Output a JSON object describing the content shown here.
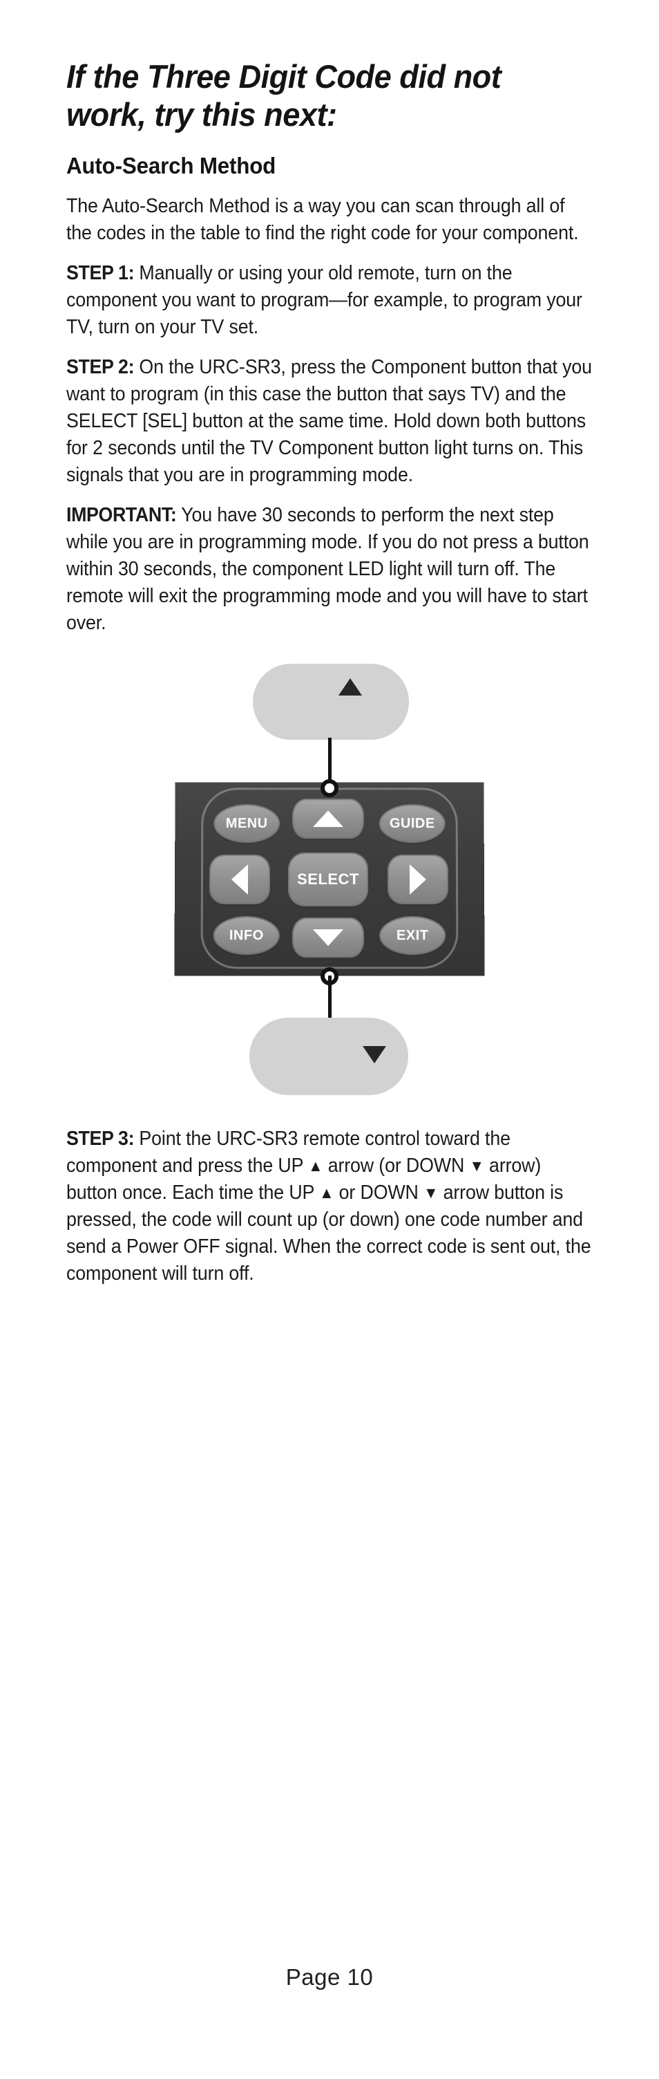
{
  "document": {
    "title": "If the Three Digit Code did not work, try this next:",
    "section_heading": "Auto-Search Method",
    "intro_paragraph": "The Auto-Search Method is a way you can scan through all of the codes in the table to find the right code for your component.",
    "steps": [
      {
        "label": "STEP 1:",
        "text": " Manually or using your old remote, turn on the component you want to program—for example, to program your TV, turn on your TV set."
      },
      {
        "label": "STEP 2:",
        "text": " On the URC-SR3, press the Component button that you want to program (in this case the button that says TV) and the SELECT [SEL] button at the same time. Hold down both buttons for 2 seconds until the TV Component button light turns on. This signals that you are in programming mode."
      }
    ],
    "important": {
      "label": "IMPORTANT:",
      "text": " You have 30 seconds to perform the next step while you are in programming mode. If you do not press a button within 30 seconds, the component LED light will turn off. The remote will exit the programming mode and you will have to start over."
    },
    "step3": {
      "label": "STEP 3:",
      "part1": " Point the URC-SR3 remote control toward the component and press the UP ",
      "up_arrow": "▲",
      "part2": " arrow (or DOWN ",
      "down_arrow": "▼",
      "part3": " arrow) button once. Each time the UP ",
      "up_arrow2": "▲",
      "part4": " or DOWN ",
      "down_arrow2": "▼",
      "part5": " arrow button is pressed, the code will count up (or down) one code number and send a Power OFF signal. When the correct code is sent out, the component will turn off."
    },
    "footer": "Page 10"
  },
  "diagram": {
    "name": "urc-sr3-navigation-pad",
    "callout_top": {
      "arrow": "▲",
      "meaning": "UP arrow button callout"
    },
    "callout_bottom": {
      "arrow": "▼",
      "meaning": "DOWN arrow button callout"
    },
    "buttons": {
      "menu": "MENU",
      "guide": "GUIDE",
      "info": "INFO",
      "exit": "EXIT",
      "select": "SELECT",
      "up": "▲",
      "down": "▼",
      "left": "◀",
      "right": "▶"
    },
    "colors": {
      "remote_body": "#3d3d3d",
      "button_face": "#8e8e8e",
      "callout_pill": "#d2d2d2",
      "leader_line": "#111111",
      "glyph": "#262626"
    }
  }
}
